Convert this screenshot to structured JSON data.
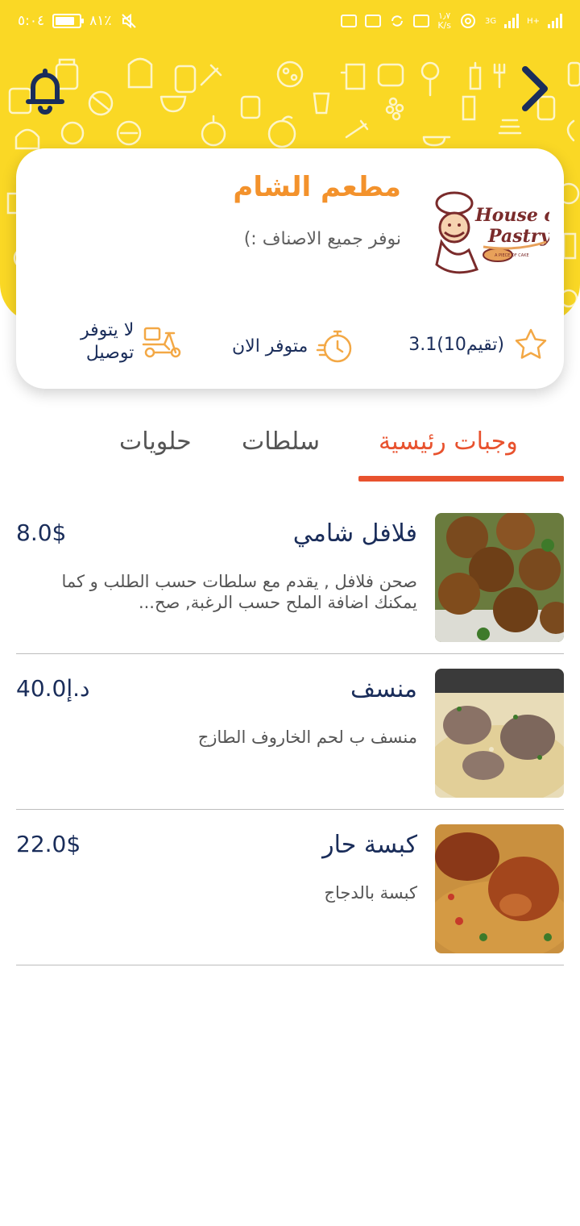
{
  "status_bar": {
    "time": "٥:٠٤",
    "battery": "٨١٪",
    "net_speed_top": "١٫٧",
    "net_speed_bottom": "K/s",
    "net_type_1": "3G",
    "net_type_2": "H+"
  },
  "header": {
    "bell_icon": "bell-icon",
    "back_icon": "chevron-right-icon",
    "accent_color": "#fad825",
    "icon_color": "#1a2d5a"
  },
  "restaurant": {
    "name": "مطعم الشام",
    "slogan": "نوفر جميع الاصناف :)",
    "logo_text": "House of Pastry",
    "logo_subtext": "A PIECE OF CAKE",
    "rating": "3.1(10تقيم)",
    "status": "متوفر الان",
    "delivery_line1": "لا يتوفر",
    "delivery_line2": "توصيل"
  },
  "tabs": [
    {
      "label": "وجبات رئيسية",
      "active": true
    },
    {
      "label": "سلطات",
      "active": false
    },
    {
      "label": "حلويات",
      "active": false
    }
  ],
  "menu": [
    {
      "name": "فلافل شامي",
      "price": "8.0$",
      "description": "صحن فلافل , يقدم مع سلطات حسب الطلب و كما  يمكنك اضافة الملح حسب الرغبة, صح..."
    },
    {
      "name": "منسف",
      "price": "40.0د.إ",
      "description": "منسف ب لحم الخاروف الطازج"
    },
    {
      "name": "كبسة حار",
      "price": "22.0$",
      "description": "كبسة بالدجاج"
    }
  ]
}
